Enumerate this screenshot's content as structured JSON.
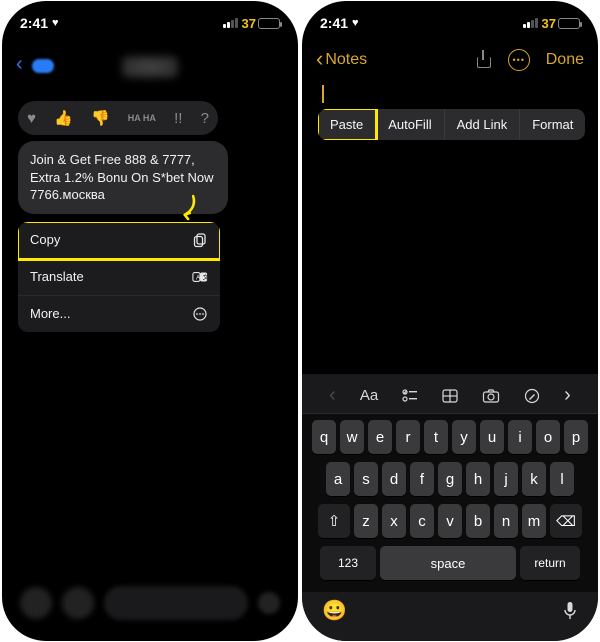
{
  "status": {
    "time": "2:41",
    "heart_icon": "♥",
    "battery_pct": "37"
  },
  "messages": {
    "reactions": [
      "♥",
      "👍",
      "👎",
      "HA HA",
      "!!",
      "?"
    ],
    "bubble_text": "Join & Get Free 888 & 7777, Extra 1.2% Bonu On S*bet Now 7766.москва",
    "menu": {
      "copy": "Copy",
      "translate": "Translate",
      "more": "More..."
    }
  },
  "notes": {
    "back_label": "Notes",
    "done_label": "Done",
    "ellipsis": "• • •",
    "context": {
      "paste": "Paste",
      "autofill": "AutoFill",
      "add_link": "Add Link",
      "format": "Format"
    }
  },
  "keyboard": {
    "toolbar": {
      "aa": "Aa"
    },
    "row1": [
      "q",
      "w",
      "e",
      "r",
      "t",
      "y",
      "u",
      "i",
      "o",
      "p"
    ],
    "row2": [
      "a",
      "s",
      "d",
      "f",
      "g",
      "h",
      "j",
      "k",
      "l"
    ],
    "row3": [
      "z",
      "x",
      "c",
      "v",
      "b",
      "n",
      "m"
    ],
    "shift": "⇧",
    "del": "⌫",
    "k123": "123",
    "space": "space",
    "enter": "return",
    "emoji": "😀"
  },
  "annotation": {
    "highlight_color": "#ffe900"
  }
}
